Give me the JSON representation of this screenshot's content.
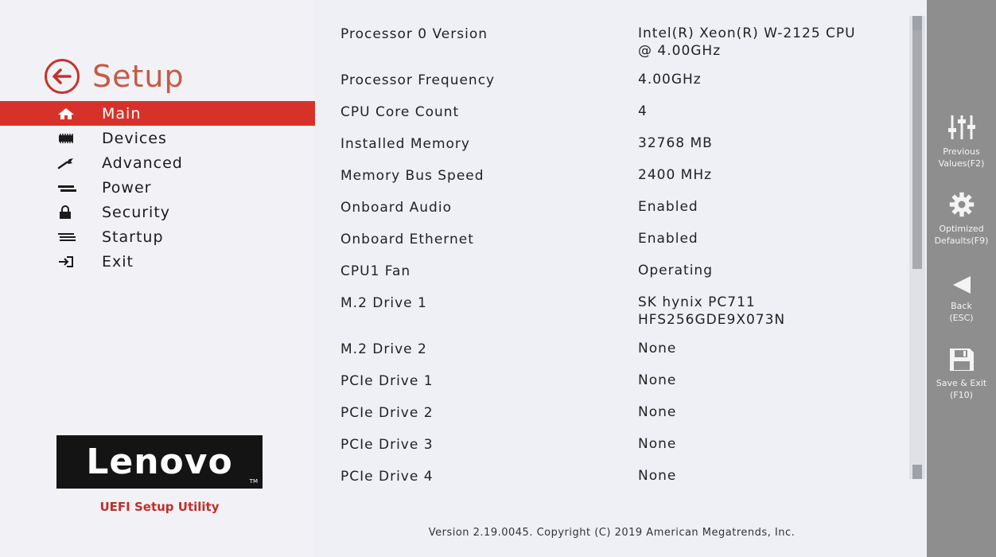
{
  "setup": {
    "title": "Setup"
  },
  "menu": [
    {
      "label": "Main",
      "icon": "home-icon",
      "active": true
    },
    {
      "label": "Devices",
      "icon": "devices-icon",
      "active": false
    },
    {
      "label": "Advanced",
      "icon": "wrench-icon",
      "active": false
    },
    {
      "label": "Power",
      "icon": "power-icon",
      "active": false
    },
    {
      "label": "Security",
      "icon": "lock-icon",
      "active": false
    },
    {
      "label": "Startup",
      "icon": "startup-icon",
      "active": false
    },
    {
      "label": "Exit",
      "icon": "exit-icon",
      "active": false
    }
  ],
  "brand": {
    "logo": "Lenovo",
    "tm": "TM",
    "utility": "UEFI Setup Utility"
  },
  "rows": [
    {
      "label": "Processor 0 Version",
      "value": "Intel(R) Xeon(R) W-2125 CPU",
      "value2": "@ 4.00GHz"
    },
    {
      "label": "Processor Frequency",
      "value": "4.00GHz"
    },
    {
      "label": "CPU Core Count",
      "value": "4"
    },
    {
      "label": "Installed Memory",
      "value": "32768 MB"
    },
    {
      "label": "Memory Bus Speed",
      "value": "2400 MHz"
    },
    {
      "label": "Onboard Audio",
      "value": "Enabled"
    },
    {
      "label": "Onboard Ethernet",
      "value": "Enabled"
    },
    {
      "label": "CPU1 Fan",
      "value": "Operating"
    },
    {
      "label": "M.2 Drive 1",
      "value": "SK hynix PC711",
      "value2": "HFS256GDE9X073N"
    },
    {
      "label": "M.2 Drive 2",
      "value": "None"
    },
    {
      "label": "PCIe Drive 1",
      "value": "None"
    },
    {
      "label": "PCIe Drive 2",
      "value": "None"
    },
    {
      "label": "PCIe Drive 3",
      "value": "None"
    },
    {
      "label": "PCIe Drive 4",
      "value": "None"
    }
  ],
  "footer": {
    "text": "Version 2.19.0045. Copyright (C) 2019 American Megatrends, Inc."
  },
  "sidebar": {
    "previous": {
      "line1": "Previous",
      "line2": "Values(F2)"
    },
    "optimized": {
      "line1": "Optimized",
      "line2": "Defaults(F9)"
    },
    "back": {
      "line1": "Back",
      "line2": "(ESC)"
    },
    "save": {
      "line1": "Save & Exit",
      "line2": "(F10)"
    }
  },
  "colors": {
    "accent": "#d7322a",
    "sidebar": "#8e8e8e",
    "background": "#eef0f6"
  }
}
